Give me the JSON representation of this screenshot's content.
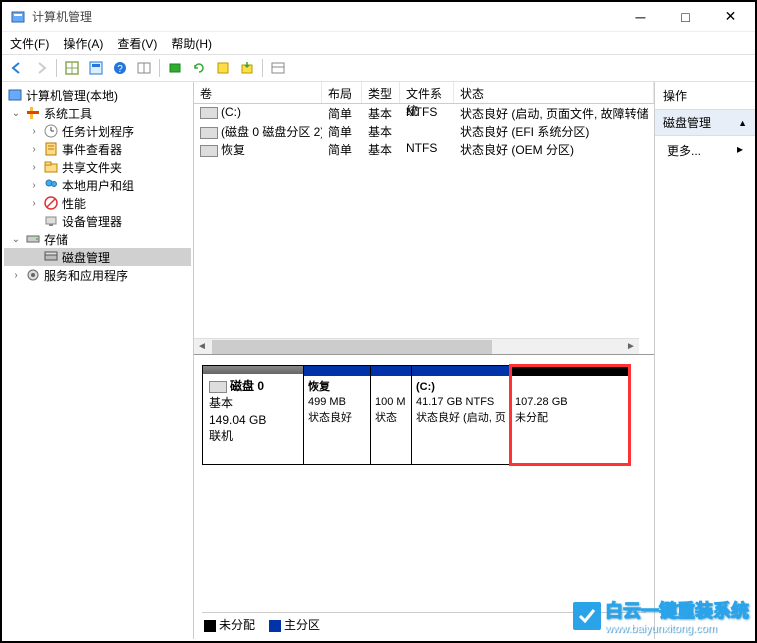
{
  "window": {
    "title": "计算机管理"
  },
  "menu": {
    "file": "文件(F)",
    "action": "操作(A)",
    "view": "查看(V)",
    "help": "帮助(H)"
  },
  "tree": {
    "root": "计算机管理(本地)",
    "system_tools": "系统工具",
    "task_scheduler": "任务计划程序",
    "event_viewer": "事件查看器",
    "shared_folders": "共享文件夹",
    "local_users": "本地用户和组",
    "performance": "性能",
    "device_manager": "设备管理器",
    "storage": "存储",
    "disk_management": "磁盘管理",
    "services": "服务和应用程序"
  },
  "vol_headers": {
    "volume": "卷",
    "layout": "布局",
    "type": "类型",
    "fs": "文件系统",
    "status": "状态"
  },
  "volumes": [
    {
      "name": "(C:)",
      "layout": "简单",
      "type": "基本",
      "fs": "NTFS",
      "status": "状态良好 (启动, 页面文件, 故障转储"
    },
    {
      "name": "(磁盘 0 磁盘分区 2)",
      "layout": "简单",
      "type": "基本",
      "fs": "",
      "status": "状态良好 (EFI 系统分区)"
    },
    {
      "name": "恢复",
      "layout": "简单",
      "type": "基本",
      "fs": "NTFS",
      "status": "状态良好 (OEM 分区)"
    }
  ],
  "disk": {
    "label": "磁盘 0",
    "type": "基本",
    "size": "149.04 GB",
    "status": "联机"
  },
  "partitions": [
    {
      "name": "恢复",
      "size": "499 MB",
      "status": "状态良好"
    },
    {
      "name": "",
      "size": "100 M",
      "status": "状态"
    },
    {
      "name": "(C:)",
      "size": "41.17 GB NTFS",
      "status": "状态良好 (启动, 页"
    },
    {
      "name": "",
      "size": "107.28 GB",
      "status": "未分配"
    }
  ],
  "legend": {
    "unallocated": "未分配",
    "primary": "主分区"
  },
  "actions": {
    "header": "操作",
    "category": "磁盘管理",
    "more": "更多..."
  },
  "watermark": {
    "brand": "白云一键重装系统",
    "url": "www.baiyunxitong.com"
  }
}
